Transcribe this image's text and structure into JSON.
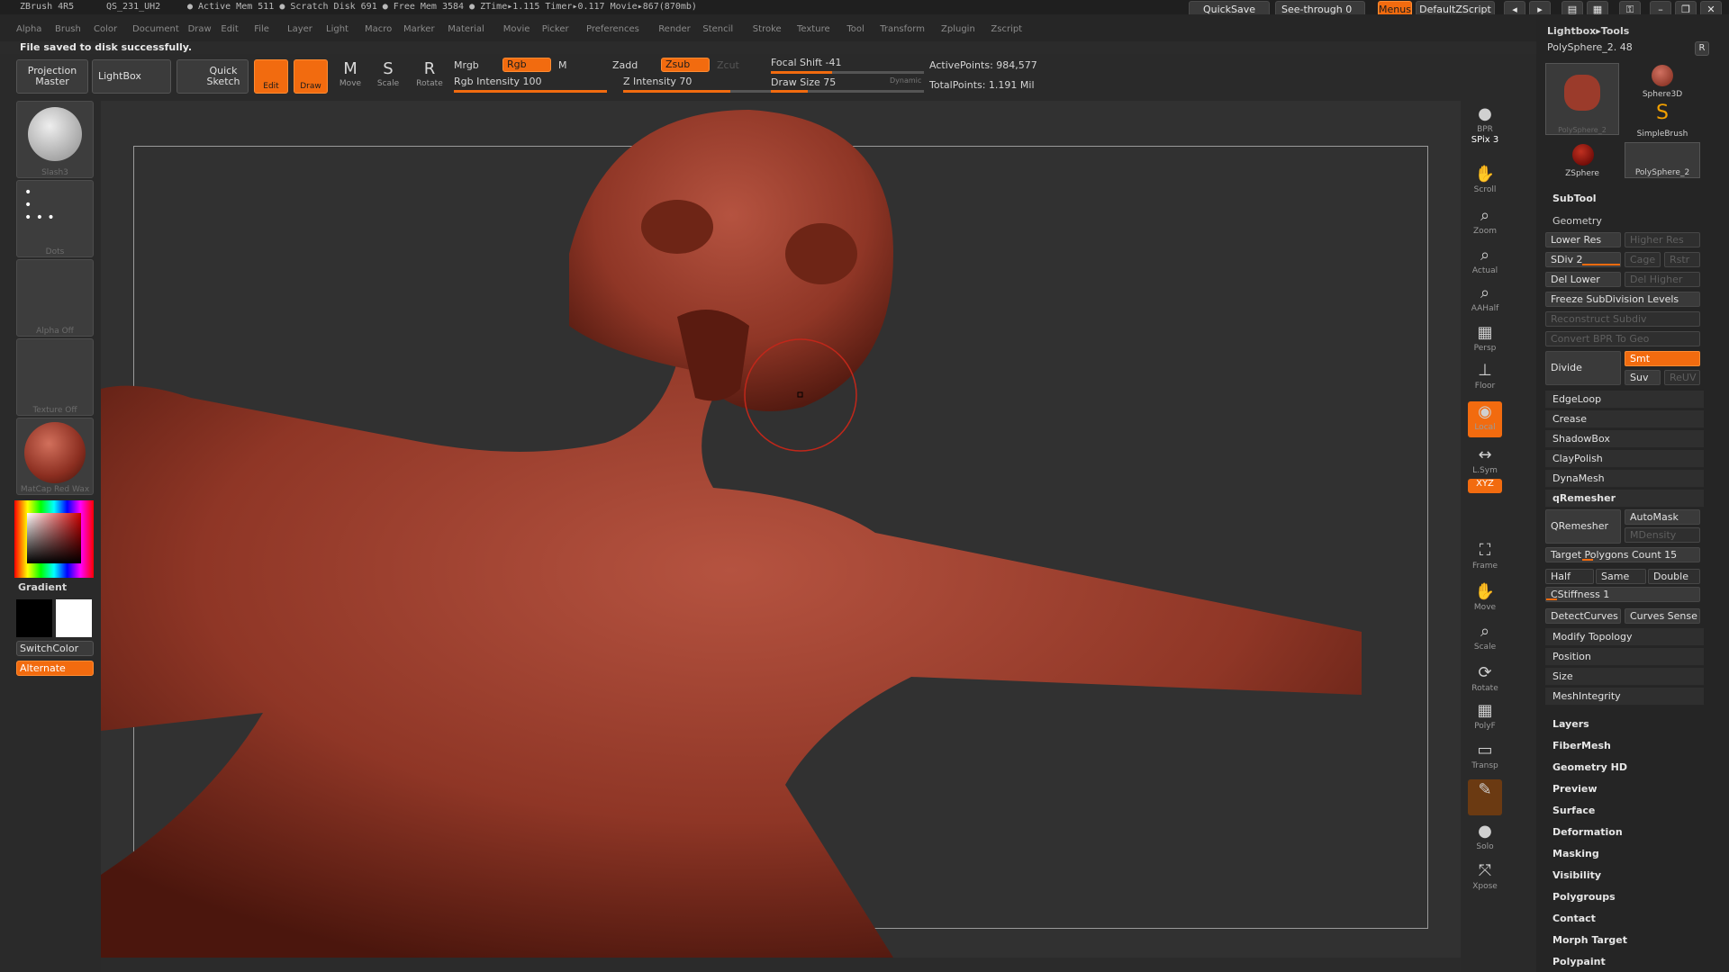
{
  "titlebar": {
    "app": "ZBrush 4R5",
    "file": "QS_231_UH2",
    "stats": "● Active Mem 511  ● Scratch Disk 691  ● Free Mem 3584  ● ZTime▸1.115 Timer▸0.117 Movie▸867(870mb)",
    "quicksave": "QuickSave",
    "seethrough": "See-through  0",
    "menus": "Menus",
    "script": "DefaultZScript"
  },
  "menu": [
    "Alpha",
    "Brush",
    "Color",
    "Document",
    "Draw",
    "Edit",
    "File",
    "Layer",
    "Light",
    "Macro",
    "Marker",
    "Material",
    "Movie",
    "Picker",
    "Preferences",
    "Render",
    "Stencil",
    "Stroke",
    "Texture",
    "Tool",
    "Transform",
    "Zplugin",
    "Zscript"
  ],
  "status": "File saved to disk successfully.",
  "shelf": {
    "projection": "Projection Master",
    "lightbox": "LightBox",
    "quicksketch": "Quick Sketch",
    "edit": "Edit",
    "draw": "Draw",
    "move": "Move",
    "scale": "Scale",
    "rotate": "Rotate",
    "mrgb": "Mrgb",
    "rgb": "Rgb",
    "m": "M",
    "rgb_intensity": "Rgb Intensity 100",
    "zadd": "Zadd",
    "zsub": "Zsub",
    "zcut": "Zcut",
    "z_intensity": "Z Intensity 70",
    "focal_shift": "Focal Shift -41",
    "draw_size": "Draw Size 75",
    "dynamic": "Dynamic",
    "active_points": "ActivePoints: 984,577",
    "total_points": "TotalPoints: 1.191 Mil"
  },
  "left": {
    "brush": "Slash3",
    "stroke": "Dots",
    "alpha": "Alpha Off",
    "texture": "Texture Off",
    "material": "MatCap Red Wax",
    "gradient": "Gradient",
    "switchcolor": "SwitchColor",
    "alternate": "Alternate"
  },
  "right_shelf": [
    {
      "icon": "bpr-icon",
      "label": "BPR"
    },
    {
      "icon": "spix-icon",
      "label": "SPix 3"
    },
    {
      "icon": "scroll-icon",
      "label": "Scroll"
    },
    {
      "icon": "zoom-icon",
      "label": "Zoom"
    },
    {
      "icon": "actual-icon",
      "label": "Actual"
    },
    {
      "icon": "aahalf-icon",
      "label": "AAHalf"
    },
    {
      "icon": "persp-icon",
      "label": "Persp"
    },
    {
      "icon": "floor-icon",
      "label": "Floor"
    },
    {
      "icon": "local-icon",
      "label": "Local"
    },
    {
      "icon": "lsym-icon",
      "label": "L.Sym"
    },
    {
      "icon": "xyz-icon",
      "label": "XYZ"
    },
    {
      "icon": "frame-icon",
      "label": "Frame"
    },
    {
      "icon": "move-icon",
      "label": "Move"
    },
    {
      "icon": "scale-icon",
      "label": "Scale"
    },
    {
      "icon": "rotate-icon",
      "label": "Rotate"
    },
    {
      "icon": "polyf-icon",
      "label": "PolyF"
    },
    {
      "icon": "transp-icon",
      "label": "Transp"
    },
    {
      "icon": "ghost-icon",
      "label": ""
    },
    {
      "icon": "solo-icon",
      "label": "Solo"
    },
    {
      "icon": "xpose-icon",
      "label": "Xpose"
    }
  ],
  "panel": {
    "header": "Lightbox▸Tools",
    "tool": "PolySphere_2. 48",
    "r": "R",
    "thumbs": [
      "PolySphere_2",
      "Sphere3D",
      "SimpleBrush",
      "ZSphere",
      "PolySphere_2"
    ],
    "subtool": "SubTool",
    "geometry": "Geometry",
    "lowerres": "Lower Res",
    "higherres": "Higher Res",
    "sdiv": "SDiv 2",
    "cage": "Cage",
    "rstr": "Rstr",
    "dellower": "Del Lower",
    "delhigher": "Del Higher",
    "freeze": "Freeze SubDivision Levels",
    "reconstruct": "Reconstruct Subdiv",
    "convertbpr": "Convert BPR To Geo",
    "divide": "Divide",
    "smt": "Smt",
    "suv": "Suv",
    "reuv": "ReUV",
    "edgeloop": "EdgeLoop",
    "crease": "Crease",
    "shadowbox": "ShadowBox",
    "claypolish": "ClayPolish",
    "dynamesh": "DynaMesh",
    "qremesher": "qRemesher",
    "qremesher_btn": "QRemesher",
    "automask": "AutoMask",
    "mdensity": "MDensity",
    "target": "Target Polygons Count 15",
    "half": "Half",
    "same": "Same",
    "double": "Double",
    "cstiffness": "CStiffness 1",
    "detectcurves": "DetectCurves",
    "curvessense": "Curves Sense",
    "modify": "Modify Topology",
    "position": "Position",
    "size": "Size",
    "meshintegrity": "MeshIntegrity",
    "categories": [
      "Layers",
      "FiberMesh",
      "Geometry HD",
      "Preview",
      "Surface",
      "Deformation",
      "Masking",
      "Visibility",
      "Polygroups",
      "Contact",
      "Morph Target",
      "Polypaint"
    ]
  }
}
